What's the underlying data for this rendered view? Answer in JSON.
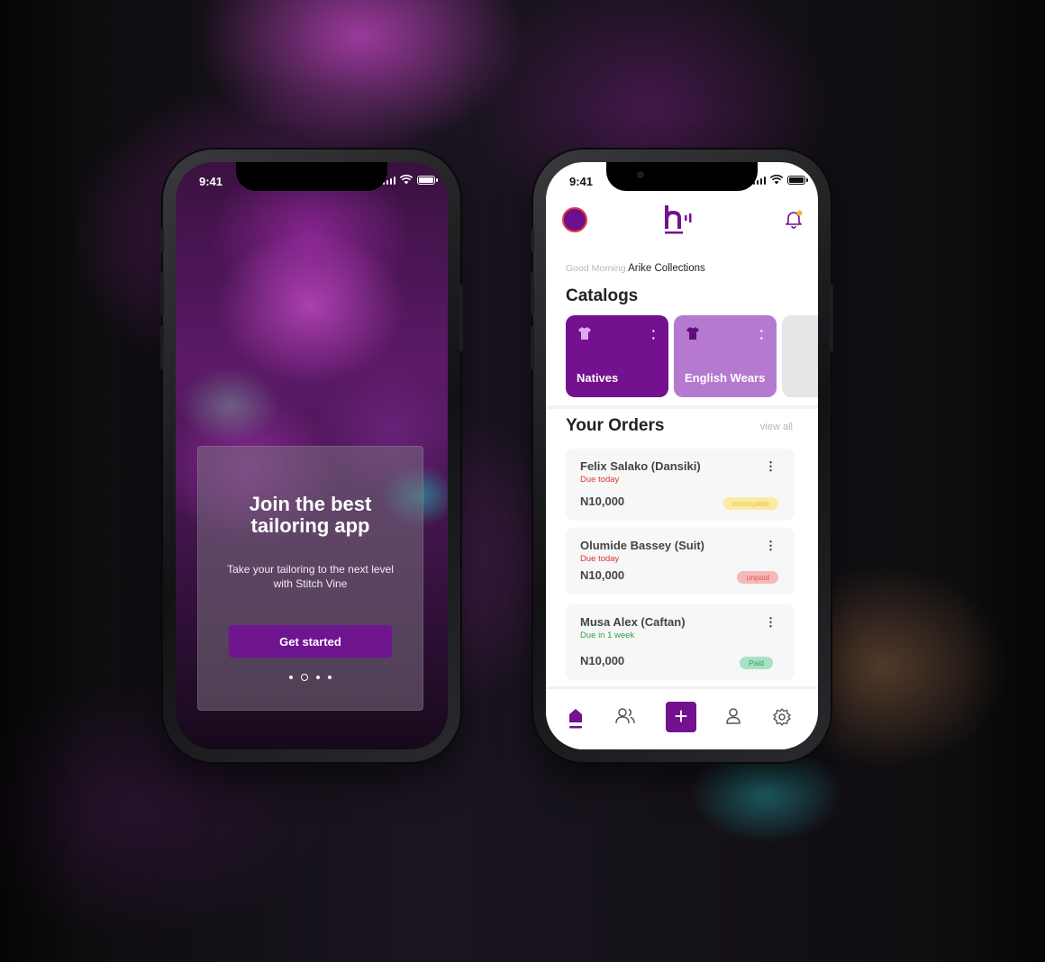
{
  "onboarding": {
    "status_time": "9:41",
    "title_line1": "Join the best",
    "title_line2": "tailoring app",
    "subtitle_line1": "Take your tailoring to the next level",
    "subtitle_line2": "with Stitch Vine",
    "cta_label": "Get started",
    "page_index": 2,
    "page_count": 4
  },
  "home": {
    "status_time": "9:41",
    "greeting_prefix": "Good Morning",
    "business_name": "Arike Collections",
    "catalogs_heading": "Catalogs",
    "catalogs": [
      {
        "label": "Natives",
        "icon": "shirt-icon",
        "color": "#73118f"
      },
      {
        "label": "English Wears",
        "icon": "shirt-icon",
        "color": "#b57ad0"
      }
    ],
    "orders_heading": "Your Orders",
    "view_all_label": "view all",
    "orders": [
      {
        "customer": "Felix Salako (Dansiki)",
        "due": "Due today",
        "due_color": "#e03131",
        "amount": "N10,000",
        "status": "incomplete",
        "status_bg": "#fbeaa2",
        "status_fg": "#e2c446"
      },
      {
        "customer": "Olumide Bassey (Suit)",
        "due": "Due  today",
        "due_color": "#e03131",
        "amount": "N10,000",
        "status": "unpaid",
        "status_bg": "#f6b9b9",
        "status_fg": "#e25656"
      },
      {
        "customer": "Musa Alex (Caftan)",
        "due": "Due in 1 week",
        "due_color": "#2f9e44",
        "amount": "N10,000",
        "status": "Paid",
        "status_bg": "#a9e2c2",
        "status_fg": "#2f9e68"
      }
    ],
    "nav": [
      "home-icon",
      "customers-icon",
      "add-icon",
      "profile-icon",
      "settings-icon"
    ],
    "brand_color": "#73118f"
  }
}
